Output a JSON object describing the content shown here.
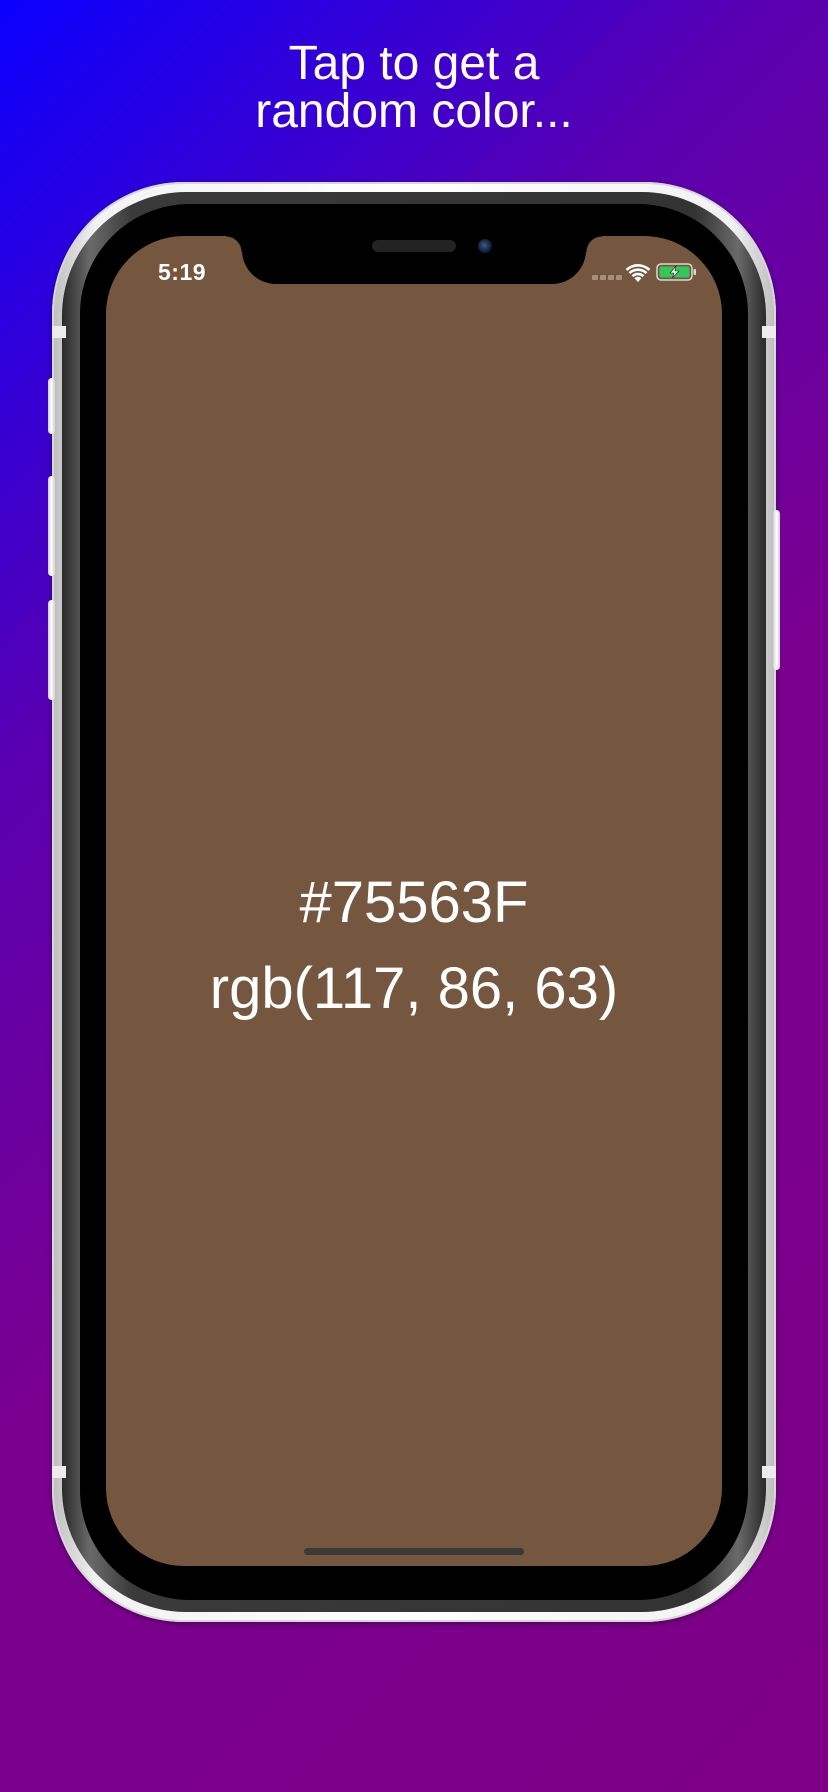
{
  "header": {
    "line1": "Tap to get a",
    "line2": "random color..."
  },
  "status_bar": {
    "time": "5:19",
    "icons": [
      "signal-icon",
      "wifi-icon",
      "battery-charging-icon"
    ]
  },
  "color_display": {
    "hex": "#75563F",
    "rgb": "rgb(117, 86, 63)",
    "swatch_color": "#75563F"
  },
  "colors": {
    "gradient_start": "#0a00ff",
    "gradient_end": "#7d0086",
    "text": "#ffffff"
  }
}
